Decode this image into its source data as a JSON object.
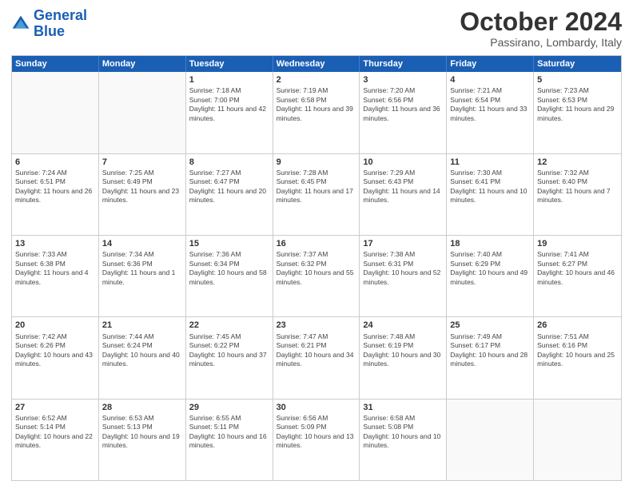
{
  "header": {
    "logo_general": "General",
    "logo_blue": "Blue",
    "month_title": "October 2024",
    "location": "Passirano, Lombardy, Italy"
  },
  "days_of_week": [
    "Sunday",
    "Monday",
    "Tuesday",
    "Wednesday",
    "Thursday",
    "Friday",
    "Saturday"
  ],
  "weeks": [
    [
      {
        "day": "",
        "sunrise": "",
        "sunset": "",
        "daylight": "",
        "empty": true
      },
      {
        "day": "",
        "sunrise": "",
        "sunset": "",
        "daylight": "",
        "empty": true
      },
      {
        "day": "1",
        "sunrise": "Sunrise: 7:18 AM",
        "sunset": "Sunset: 7:00 PM",
        "daylight": "Daylight: 11 hours and 42 minutes."
      },
      {
        "day": "2",
        "sunrise": "Sunrise: 7:19 AM",
        "sunset": "Sunset: 6:58 PM",
        "daylight": "Daylight: 11 hours and 39 minutes."
      },
      {
        "day": "3",
        "sunrise": "Sunrise: 7:20 AM",
        "sunset": "Sunset: 6:56 PM",
        "daylight": "Daylight: 11 hours and 36 minutes."
      },
      {
        "day": "4",
        "sunrise": "Sunrise: 7:21 AM",
        "sunset": "Sunset: 6:54 PM",
        "daylight": "Daylight: 11 hours and 33 minutes."
      },
      {
        "day": "5",
        "sunrise": "Sunrise: 7:23 AM",
        "sunset": "Sunset: 6:53 PM",
        "daylight": "Daylight: 11 hours and 29 minutes."
      }
    ],
    [
      {
        "day": "6",
        "sunrise": "Sunrise: 7:24 AM",
        "sunset": "Sunset: 6:51 PM",
        "daylight": "Daylight: 11 hours and 26 minutes."
      },
      {
        "day": "7",
        "sunrise": "Sunrise: 7:25 AM",
        "sunset": "Sunset: 6:49 PM",
        "daylight": "Daylight: 11 hours and 23 minutes."
      },
      {
        "day": "8",
        "sunrise": "Sunrise: 7:27 AM",
        "sunset": "Sunset: 6:47 PM",
        "daylight": "Daylight: 11 hours and 20 minutes."
      },
      {
        "day": "9",
        "sunrise": "Sunrise: 7:28 AM",
        "sunset": "Sunset: 6:45 PM",
        "daylight": "Daylight: 11 hours and 17 minutes."
      },
      {
        "day": "10",
        "sunrise": "Sunrise: 7:29 AM",
        "sunset": "Sunset: 6:43 PM",
        "daylight": "Daylight: 11 hours and 14 minutes."
      },
      {
        "day": "11",
        "sunrise": "Sunrise: 7:30 AM",
        "sunset": "Sunset: 6:41 PM",
        "daylight": "Daylight: 11 hours and 10 minutes."
      },
      {
        "day": "12",
        "sunrise": "Sunrise: 7:32 AM",
        "sunset": "Sunset: 6:40 PM",
        "daylight": "Daylight: 11 hours and 7 minutes."
      }
    ],
    [
      {
        "day": "13",
        "sunrise": "Sunrise: 7:33 AM",
        "sunset": "Sunset: 6:38 PM",
        "daylight": "Daylight: 11 hours and 4 minutes."
      },
      {
        "day": "14",
        "sunrise": "Sunrise: 7:34 AM",
        "sunset": "Sunset: 6:36 PM",
        "daylight": "Daylight: 11 hours and 1 minute."
      },
      {
        "day": "15",
        "sunrise": "Sunrise: 7:36 AM",
        "sunset": "Sunset: 6:34 PM",
        "daylight": "Daylight: 10 hours and 58 minutes."
      },
      {
        "day": "16",
        "sunrise": "Sunrise: 7:37 AM",
        "sunset": "Sunset: 6:32 PM",
        "daylight": "Daylight: 10 hours and 55 minutes."
      },
      {
        "day": "17",
        "sunrise": "Sunrise: 7:38 AM",
        "sunset": "Sunset: 6:31 PM",
        "daylight": "Daylight: 10 hours and 52 minutes."
      },
      {
        "day": "18",
        "sunrise": "Sunrise: 7:40 AM",
        "sunset": "Sunset: 6:29 PM",
        "daylight": "Daylight: 10 hours and 49 minutes."
      },
      {
        "day": "19",
        "sunrise": "Sunrise: 7:41 AM",
        "sunset": "Sunset: 6:27 PM",
        "daylight": "Daylight: 10 hours and 46 minutes."
      }
    ],
    [
      {
        "day": "20",
        "sunrise": "Sunrise: 7:42 AM",
        "sunset": "Sunset: 6:26 PM",
        "daylight": "Daylight: 10 hours and 43 minutes."
      },
      {
        "day": "21",
        "sunrise": "Sunrise: 7:44 AM",
        "sunset": "Sunset: 6:24 PM",
        "daylight": "Daylight: 10 hours and 40 minutes."
      },
      {
        "day": "22",
        "sunrise": "Sunrise: 7:45 AM",
        "sunset": "Sunset: 6:22 PM",
        "daylight": "Daylight: 10 hours and 37 minutes."
      },
      {
        "day": "23",
        "sunrise": "Sunrise: 7:47 AM",
        "sunset": "Sunset: 6:21 PM",
        "daylight": "Daylight: 10 hours and 34 minutes."
      },
      {
        "day": "24",
        "sunrise": "Sunrise: 7:48 AM",
        "sunset": "Sunset: 6:19 PM",
        "daylight": "Daylight: 10 hours and 30 minutes."
      },
      {
        "day": "25",
        "sunrise": "Sunrise: 7:49 AM",
        "sunset": "Sunset: 6:17 PM",
        "daylight": "Daylight: 10 hours and 28 minutes."
      },
      {
        "day": "26",
        "sunrise": "Sunrise: 7:51 AM",
        "sunset": "Sunset: 6:16 PM",
        "daylight": "Daylight: 10 hours and 25 minutes."
      }
    ],
    [
      {
        "day": "27",
        "sunrise": "Sunrise: 6:52 AM",
        "sunset": "Sunset: 5:14 PM",
        "daylight": "Daylight: 10 hours and 22 minutes."
      },
      {
        "day": "28",
        "sunrise": "Sunrise: 6:53 AM",
        "sunset": "Sunset: 5:13 PM",
        "daylight": "Daylight: 10 hours and 19 minutes."
      },
      {
        "day": "29",
        "sunrise": "Sunrise: 6:55 AM",
        "sunset": "Sunset: 5:11 PM",
        "daylight": "Daylight: 10 hours and 16 minutes."
      },
      {
        "day": "30",
        "sunrise": "Sunrise: 6:56 AM",
        "sunset": "Sunset: 5:09 PM",
        "daylight": "Daylight: 10 hours and 13 minutes."
      },
      {
        "day": "31",
        "sunrise": "Sunrise: 6:58 AM",
        "sunset": "Sunset: 5:08 PM",
        "daylight": "Daylight: 10 hours and 10 minutes."
      },
      {
        "day": "",
        "sunrise": "",
        "sunset": "",
        "daylight": "",
        "empty": true
      },
      {
        "day": "",
        "sunrise": "",
        "sunset": "",
        "daylight": "",
        "empty": true
      }
    ]
  ]
}
